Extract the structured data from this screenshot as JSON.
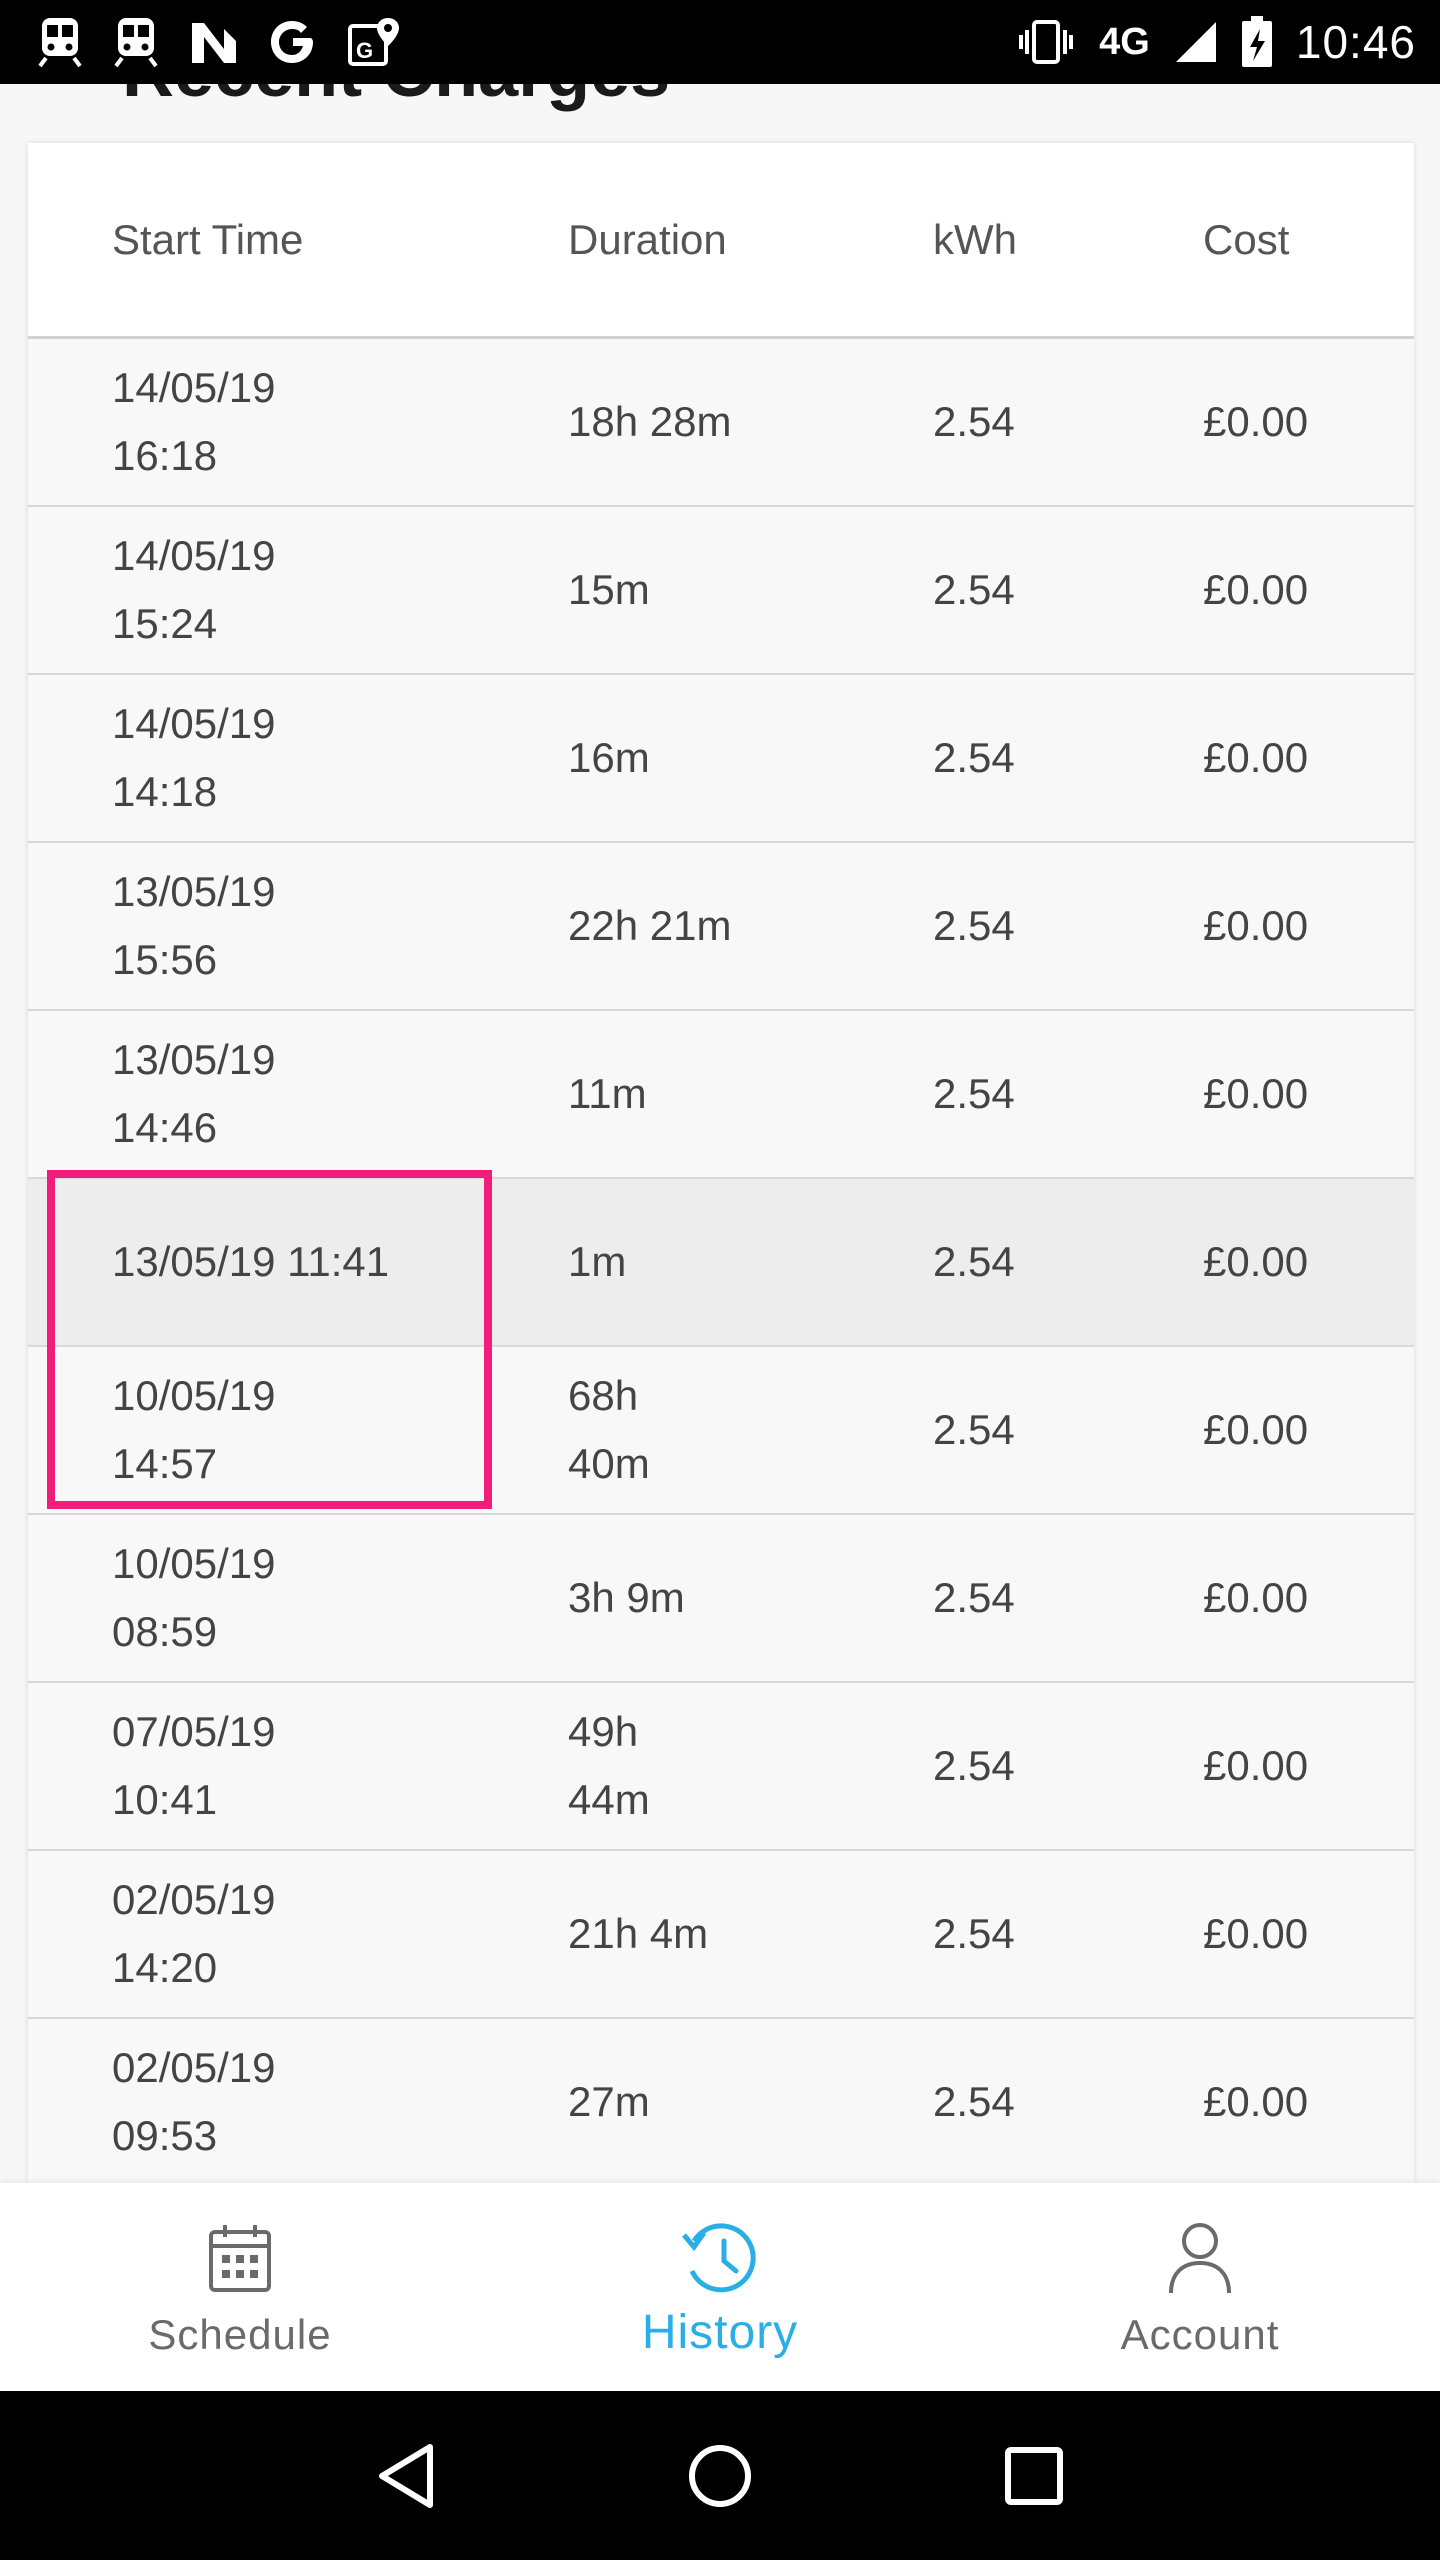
{
  "status_bar": {
    "network": "4G",
    "time": "10:46",
    "left_icons": [
      "train-icon",
      "train-icon",
      "n-notification-icon",
      "google-icon",
      "maps-icon"
    ],
    "right_icons": [
      "vibrate-icon",
      "signal-icon",
      "battery-icon"
    ]
  },
  "page": {
    "heading": "Recent Charges"
  },
  "table": {
    "headers": {
      "start_time": "Start Time",
      "duration": "Duration",
      "kwh": "kWh",
      "cost": "Cost"
    },
    "rows": [
      {
        "start": "14/05/19\n16:18",
        "duration": "18h 28m",
        "kwh": "2.54",
        "cost": "£0.00"
      },
      {
        "start": "14/05/19\n15:24",
        "duration": "15m",
        "kwh": "2.54",
        "cost": "£0.00"
      },
      {
        "start": "14/05/19\n14:18",
        "duration": "16m",
        "kwh": "2.54",
        "cost": "£0.00"
      },
      {
        "start": "13/05/19\n15:56",
        "duration": "22h 21m",
        "kwh": "2.54",
        "cost": "£0.00"
      },
      {
        "start": "13/05/19\n14:46",
        "duration": "11m",
        "kwh": "2.54",
        "cost": "£0.00"
      },
      {
        "start": "13/05/19 11:41",
        "duration": "1m",
        "kwh": "2.54",
        "cost": "£0.00"
      },
      {
        "start": "10/05/19\n14:57",
        "duration": "68h\n40m",
        "kwh": "2.54",
        "cost": "£0.00"
      },
      {
        "start": "10/05/19\n08:59",
        "duration": "3h 9m",
        "kwh": "2.54",
        "cost": "£0.00"
      },
      {
        "start": "07/05/19\n10:41",
        "duration": "49h\n44m",
        "kwh": "2.54",
        "cost": "£0.00"
      },
      {
        "start": "02/05/19\n14:20",
        "duration": "21h 4m",
        "kwh": "2.54",
        "cost": "£0.00"
      },
      {
        "start": "02/05/19\n09:53",
        "duration": "27m",
        "kwh": "2.54",
        "cost": "£0.00"
      }
    ]
  },
  "bottom_nav": {
    "items": [
      {
        "label": "Schedule",
        "icon": "calendar-icon"
      },
      {
        "label": "History",
        "icon": "history-icon",
        "active": true
      },
      {
        "label": "Account",
        "icon": "person-icon"
      }
    ]
  },
  "colors": {
    "accent": "#29aee6",
    "annotation": "#f21d7b",
    "highlight_row": "#ededed"
  }
}
